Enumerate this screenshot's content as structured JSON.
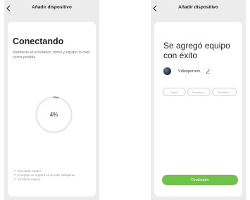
{
  "screen1": {
    "title": "Añadir dispositivo",
    "heading": "Conectando",
    "subtitle": "Mantener el enrutador, móvil y equipo lo más cerca posible",
    "progress_text": "4%",
    "progress_fraction": 0.04,
    "steps": [
      "Encontrar equipo",
      "El equipo se registra en la nube inteligente",
      "Inicializar equipo"
    ],
    "colors": {
      "accent": "#72c14a",
      "ring": "#e6e6e6"
    }
  },
  "screen2": {
    "title": "Añadir dispositivo",
    "heading": "Se agregó equipo con éxito",
    "device_name": "Videoportero",
    "chips": [
      "Salón",
      "Dormitori...",
      "Dormitori..."
    ],
    "finish_label": "Finalizado",
    "colors": {
      "accent": "#72c14a"
    }
  }
}
